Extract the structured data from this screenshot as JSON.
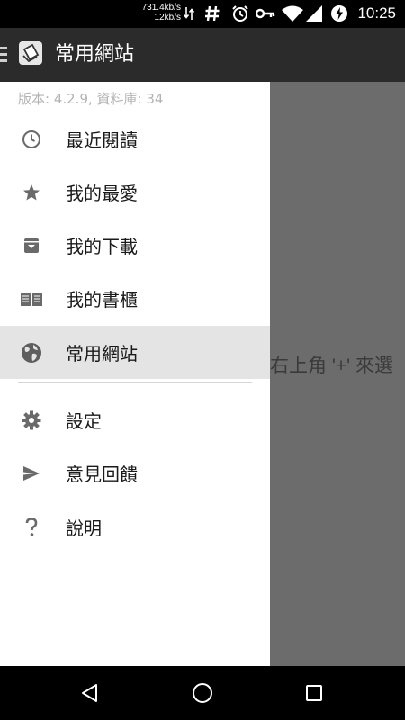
{
  "status_bar": {
    "net_down": "731.4kb/s",
    "net_up": "12kb/s",
    "time": "10:25"
  },
  "toolbar": {
    "title": "常用網站"
  },
  "background": {
    "hint_text": "右上角 '+' 來選"
  },
  "drawer": {
    "version": "版本: 4.2.9, 資料庫: 34",
    "items": [
      {
        "label": "最近閱讀",
        "icon": "clock-icon"
      },
      {
        "label": "我的最愛",
        "icon": "star-icon"
      },
      {
        "label": "我的下載",
        "icon": "download-box-icon"
      },
      {
        "label": "我的書櫃",
        "icon": "book-icon"
      },
      {
        "label": "常用網站",
        "icon": "globe-icon",
        "active": true
      },
      {
        "label": "設定",
        "icon": "gear-icon"
      },
      {
        "label": "意見回饋",
        "icon": "send-icon"
      },
      {
        "label": "說明",
        "icon": "question-icon"
      }
    ]
  }
}
